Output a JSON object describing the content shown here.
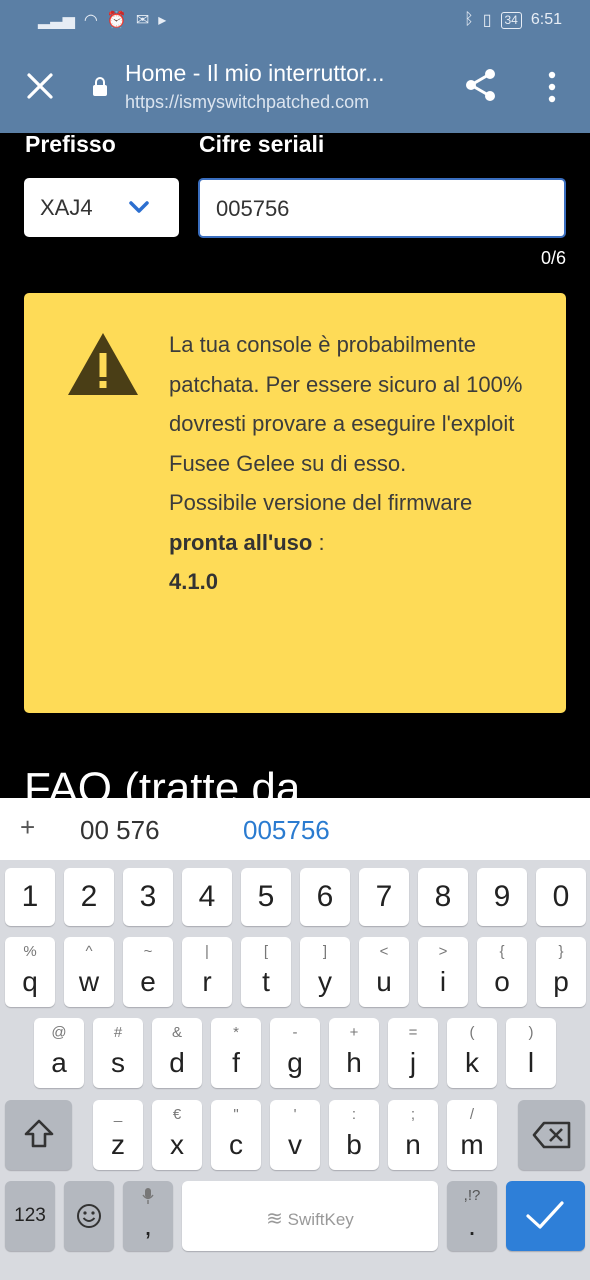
{
  "status": {
    "battery": "34",
    "time": "6:51"
  },
  "browser": {
    "title": "Home - Il mio interruttor...",
    "url": "https://ismyswitchpatched.com"
  },
  "form": {
    "prefix_label": "Prefisso",
    "serial_label": "Cifre seriali",
    "prefix_value": "XAJ4",
    "serial_value": "005756",
    "counter": "0/6"
  },
  "warning": {
    "line1": "La tua console è probabilmente patchata. Per essere sicuro al 100% dovresti provare a eseguire l'exploit Fusee Gelee su di esso.",
    "line2_prefix": "Possibile versione del firmware",
    "line2_bold": "pronta all'uso",
    "line2_suffix": " :",
    "version": "4.1.0"
  },
  "faq_heading": "FAQ (tratte da",
  "keyboard": {
    "suggestions": [
      "00 576",
      "005756"
    ],
    "plus": "+",
    "numbers": [
      "1",
      "2",
      "3",
      "4",
      "5",
      "6",
      "7",
      "8",
      "9",
      "0"
    ],
    "row1": [
      [
        "%",
        "q"
      ],
      [
        "^",
        "w"
      ],
      [
        "~",
        "e"
      ],
      [
        "|",
        "r"
      ],
      [
        "[",
        "t"
      ],
      [
        "]",
        "y"
      ],
      [
        "<",
        "u"
      ],
      [
        ">",
        "i"
      ],
      [
        "{",
        "o"
      ],
      [
        "}",
        "p"
      ]
    ],
    "row2": [
      [
        "@",
        "a"
      ],
      [
        "#",
        "s"
      ],
      [
        "&",
        "d"
      ],
      [
        "*",
        "f"
      ],
      [
        "-",
        "g"
      ],
      [
        "+",
        "h"
      ],
      [
        "=",
        "j"
      ],
      [
        "(",
        "k"
      ],
      [
        ")",
        "l"
      ]
    ],
    "row3": [
      [
        "_",
        "z"
      ],
      [
        "€",
        "x"
      ],
      [
        "\"",
        "c"
      ],
      [
        "'",
        "v"
      ],
      [
        ":",
        "b"
      ],
      [
        ";",
        "n"
      ],
      [
        "/",
        "m"
      ]
    ],
    "numbers_key": "123",
    "comma": ",",
    "period": ".",
    "period_sub": ",!?",
    "space_label": "SwiftKey"
  }
}
